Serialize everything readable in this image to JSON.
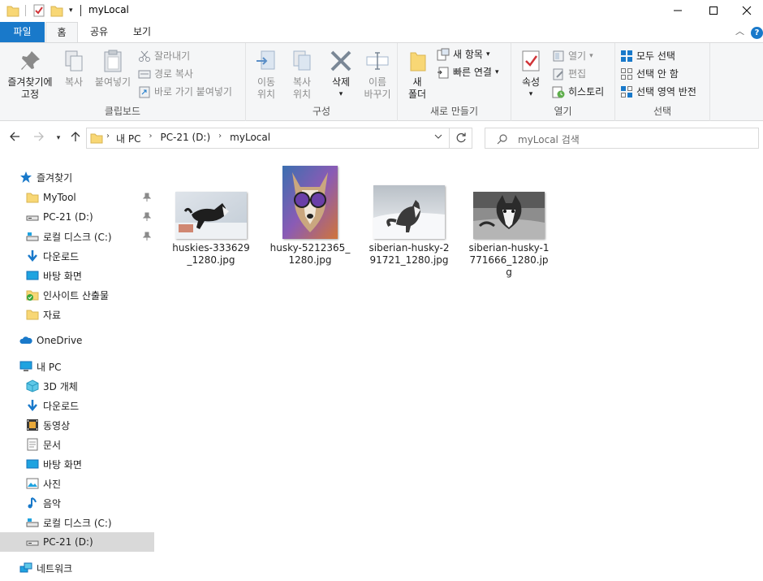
{
  "window": {
    "title": "myLocal",
    "minimize_icon": "minimize-icon",
    "maximize_icon": "maximize-icon",
    "close_icon": "close-icon"
  },
  "tabs": [
    {
      "label": "파일"
    },
    {
      "label": "홈"
    },
    {
      "label": "공유"
    },
    {
      "label": "보기"
    }
  ],
  "ribbon": {
    "clipboard": {
      "label": "클립보드",
      "pin": "즐겨찾기에\n고정",
      "copy": "복사",
      "paste": "붙여넣기",
      "cut": "잘라내기",
      "copy_path": "경로 복사",
      "paste_shortcut": "바로 가기 붙여넣기"
    },
    "organize": {
      "label": "구성",
      "move_to": "이동\n위치",
      "copy_to": "복사\n위치",
      "delete": "삭제",
      "rename": "이름\n바꾸기"
    },
    "new": {
      "label": "새로 만들기",
      "new_folder": "새\n폴더",
      "new_item": "새 항목",
      "easy_access": "빠른 연결"
    },
    "open": {
      "label": "열기",
      "properties": "속성",
      "open": "열기",
      "edit": "편집",
      "history": "히스토리"
    },
    "select": {
      "label": "선택",
      "select_all": "모두 선택",
      "select_none": "선택 안 함",
      "invert": "선택 영역 반전"
    }
  },
  "address": {
    "crumbs": [
      "내 PC",
      "PC-21 (D:)",
      "myLocal"
    ],
    "search_placeholder": "myLocal 검색"
  },
  "nav": {
    "quick_access": "즐겨찾기",
    "quick_items": [
      {
        "label": "MyTool",
        "icon": "folder-icon",
        "pinned": true
      },
      {
        "label": "PC-21 (D:)",
        "icon": "drive-icon",
        "pinned": true
      },
      {
        "label": "로컬 디스크 (C:)",
        "icon": "local-disk-icon",
        "pinned": true
      },
      {
        "label": "다운로드",
        "icon": "download-icon",
        "pinned": false
      },
      {
        "label": "바탕 화면",
        "icon": "desktop-icon",
        "pinned": false
      },
      {
        "label": "인사이트 산출물",
        "icon": "synced-folder-icon",
        "pinned": false
      },
      {
        "label": "자료",
        "icon": "folder-icon",
        "pinned": false
      }
    ],
    "onedrive": "OneDrive",
    "this_pc": "내 PC",
    "pc_items": [
      {
        "label": "3D 개체",
        "icon": "3d-objects-icon"
      },
      {
        "label": "다운로드",
        "icon": "download-icon"
      },
      {
        "label": "동영상",
        "icon": "video-icon"
      },
      {
        "label": "문서",
        "icon": "document-icon"
      },
      {
        "label": "바탕 화면",
        "icon": "desktop-icon"
      },
      {
        "label": "사진",
        "icon": "picture-icon"
      },
      {
        "label": "음악",
        "icon": "music-icon"
      },
      {
        "label": "로컬 디스크 (C:)",
        "icon": "local-disk-icon"
      },
      {
        "label": "PC-21 (D:)",
        "icon": "drive-icon"
      }
    ],
    "network": "네트워크"
  },
  "files": [
    {
      "name": "huskies-333629_1280.jpg"
    },
    {
      "name": "husky-5212365_1280.jpg"
    },
    {
      "name": "siberian-husky-291721_1280.jpg"
    },
    {
      "name": "siberian-husky-1771666_1280.jpg"
    }
  ],
  "colors": {
    "accent": "#1979ca",
    "folder": "#f8d775",
    "selected_nav": "#d9d9d9"
  }
}
